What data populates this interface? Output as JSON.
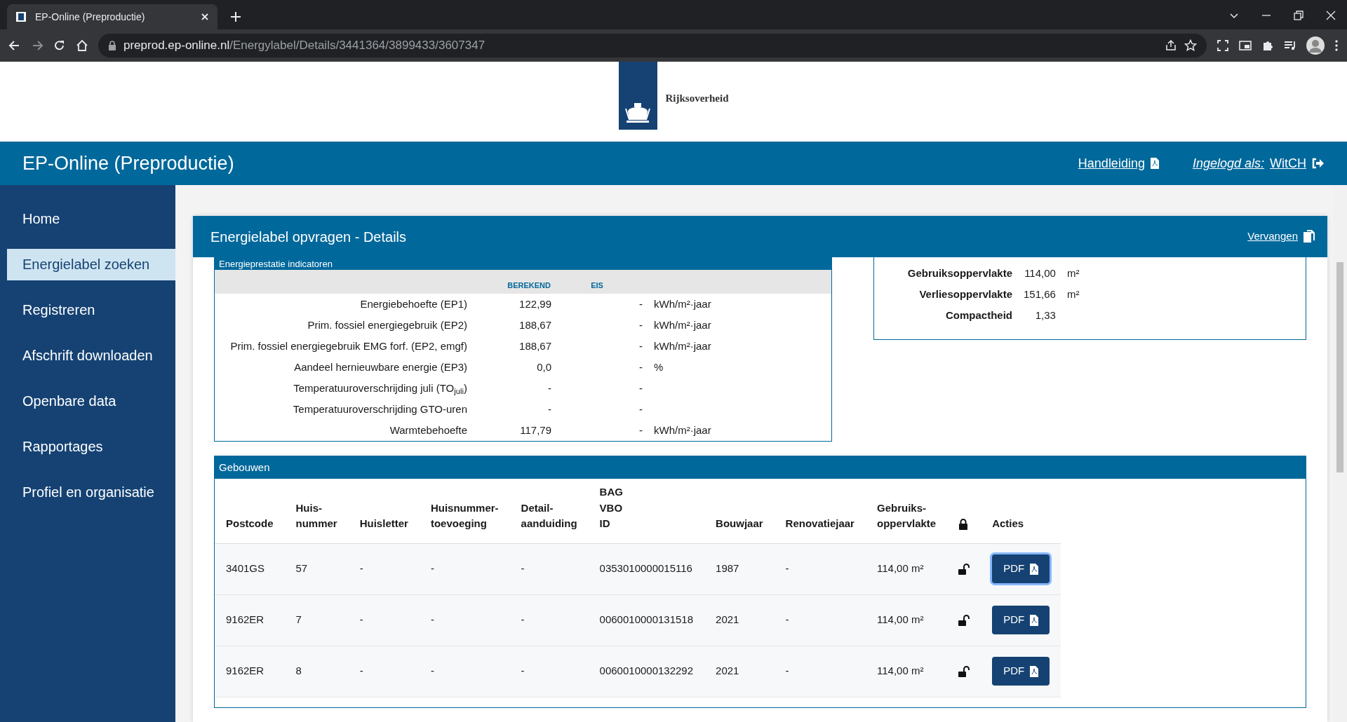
{
  "browser": {
    "tab_title": "EP-Online (Preproductie)",
    "url_host": "preprod.ep-online.nl",
    "url_path": "/Energylabel/Details/3441364/3899433/3607347"
  },
  "header": {
    "brand": "Rijksoverheid"
  },
  "navbar": {
    "title": "EP-Online (Preproductie)",
    "manual": "Handleiding",
    "login_label": "Ingelogd als:",
    "user": "WitCH"
  },
  "sidebar": {
    "items": [
      {
        "label": "Home",
        "selected": false
      },
      {
        "label": "Energielabel zoeken",
        "selected": true
      },
      {
        "label": "Registreren",
        "selected": false
      },
      {
        "label": "Afschrift downloaden",
        "selected": false
      },
      {
        "label": "Openbare data",
        "selected": false
      },
      {
        "label": "Rapportages",
        "selected": false
      },
      {
        "label": "Profiel en organisatie",
        "selected": false
      }
    ]
  },
  "panel": {
    "title": "Energielabel opvragen - Details",
    "action": "Vervangen"
  },
  "indicators": {
    "title": "Energieprestatie indicatoren",
    "columns": [
      "BEREKEND",
      "EIS"
    ],
    "rows": [
      {
        "label": "Energiebehoefte (EP1)",
        "calculated": "122,99",
        "requirement": "-",
        "unit": "kWh/m²·jaar"
      },
      {
        "label": "Prim. fossiel energiegebruik (EP2)",
        "calculated": "188,67",
        "requirement": "-",
        "unit": "kWh/m²·jaar"
      },
      {
        "label": "Prim. fossiel energiegebruik EMG forf. (EP2, emgf)",
        "calculated": "188,67",
        "requirement": "-",
        "unit": "kWh/m²·jaar"
      },
      {
        "label": "Aandeel hernieuwbare energie (EP3)",
        "calculated": "0,0",
        "requirement": "-",
        "unit": "%"
      },
      {
        "label": "Temperatuuroverschrijding juli (TO$_{juli}$)",
        "calculated": "-",
        "requirement": "-"
      },
      {
        "label": "Temperatuuroverschrijding GTO-uren",
        "calculated": "-",
        "requirement": "-"
      },
      {
        "label": "Warmtebehoefte",
        "calculated": "117,79",
        "requirement": "-",
        "unit": "kWh/m²·jaar"
      }
    ]
  },
  "areas": {
    "rows": [
      {
        "label": "Gebruiksoppervlakte",
        "value": "114,00",
        "unit": "m²"
      },
      {
        "label": "Verliesoppervlakte",
        "value": "151,66",
        "unit": "m²"
      },
      {
        "label": "Compactheid",
        "value": "1,33"
      }
    ]
  },
  "buildings": {
    "title": "Gebouwen",
    "columns": [
      {
        "kind": "text",
        "label": "Postcode"
      },
      {
        "kind": "text",
        "label": "Huis-nummer"
      },
      {
        "kind": "text",
        "label": "Huisletter"
      },
      {
        "kind": "text",
        "label": "Huisnummer-toevoeging"
      },
      {
        "kind": "text",
        "label": "Detail-aanduiding"
      },
      {
        "kind": "text",
        "label": "BAG VBO ID"
      },
      {
        "kind": "text",
        "label": "Bouwjaar"
      },
      {
        "kind": "text",
        "label": "Renovatiejaar"
      },
      {
        "kind": "text",
        "label": "Gebruiks-oppervlakte"
      },
      {
        "kind": "lock"
      },
      {
        "kind": "text",
        "label": "Acties"
      }
    ],
    "rows": [
      {
        "cells": [
          "3401GS",
          "57",
          "-",
          "-",
          "-",
          "0353010000015116",
          "1987",
          "-",
          "114,00 m²"
        ],
        "locked": false,
        "action": "PDF",
        "focused": true
      },
      {
        "cells": [
          "9162ER",
          "7",
          "-",
          "-",
          "-",
          "0060010000131518",
          "2021",
          "-",
          "114,00 m²"
        ],
        "locked": false,
        "action": "PDF",
        "focused": false
      },
      {
        "cells": [
          "9162ER",
          "8",
          "-",
          "-",
          "-",
          "0060010000132292",
          "2021",
          "-",
          "114,00 m²"
        ],
        "locked": false,
        "action": "PDF",
        "focused": false
      }
    ]
  }
}
